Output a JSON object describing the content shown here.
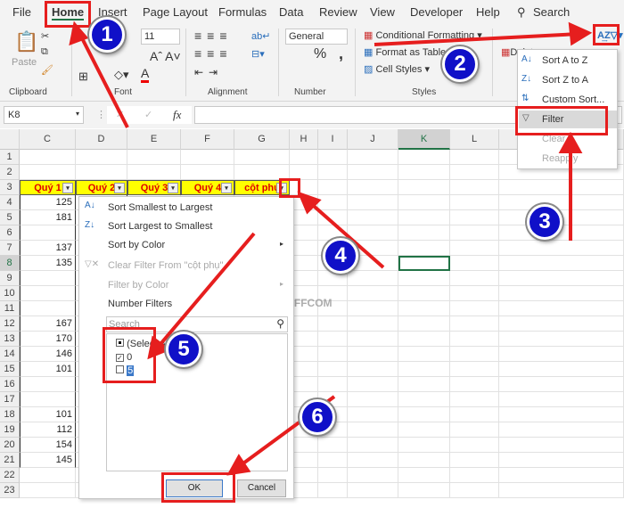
{
  "tabs": [
    "File",
    "Home",
    "Insert",
    "Page Layout",
    "Formulas",
    "Data",
    "Review",
    "View",
    "Developer",
    "Help"
  ],
  "search_label": "Search",
  "ribbon": {
    "paste": "Paste",
    "font_size": "11",
    "number_format": "General",
    "conditional_formatting": "Conditional Formatting",
    "format_as_table": "Format as Table",
    "cell_styles": "Cell Styles",
    "groups": [
      "Clipboard",
      "Font",
      "Alignment",
      "Number",
      "Styles"
    ],
    "delete": "Delete",
    "percent": "%",
    "comma": ","
  },
  "formula_bar": {
    "name_box": "K8",
    "fx": "fx",
    "value": ""
  },
  "columns": [
    "C",
    "D",
    "E",
    "F",
    "G",
    "H",
    "I",
    "J",
    "K",
    "L",
    "M"
  ],
  "header_row": [
    "Quý 1",
    "Quý 2",
    "Quý 3",
    "Quý 4",
    "cột phụ"
  ],
  "rows": [
    {
      "n": "1",
      "c": ""
    },
    {
      "n": "2",
      "c": ""
    },
    {
      "n": "3",
      "c": ""
    },
    {
      "n": "4",
      "c": "125"
    },
    {
      "n": "5",
      "c": "181"
    },
    {
      "n": "6",
      "c": ""
    },
    {
      "n": "7",
      "c": "137"
    },
    {
      "n": "8",
      "c": "135"
    },
    {
      "n": "9",
      "c": ""
    },
    {
      "n": "10",
      "c": ""
    },
    {
      "n": "11",
      "c": ""
    },
    {
      "n": "12",
      "c": "167"
    },
    {
      "n": "13",
      "c": "170"
    },
    {
      "n": "14",
      "c": "146"
    },
    {
      "n": "15",
      "c": "101"
    },
    {
      "n": "16",
      "c": ""
    },
    {
      "n": "17",
      "c": ""
    },
    {
      "n": "18",
      "c": "101"
    },
    {
      "n": "19",
      "c": "112"
    },
    {
      "n": "20",
      "c": "154"
    },
    {
      "n": "21",
      "c": "145"
    },
    {
      "n": "22",
      "c": ""
    },
    {
      "n": "23",
      "c": ""
    }
  ],
  "sort_filter_menu": {
    "items": [
      "Sort A to Z",
      "Sort Z to A",
      "Custom Sort...",
      "Filter",
      "Clear",
      "Reapply"
    ]
  },
  "filter_dropdown": {
    "sort_asc": "Sort Smallest to Largest",
    "sort_desc": "Sort Largest to Smallest",
    "sort_color": "Sort by Color",
    "clear_filter": "Clear Filter From \"cột phụ\"",
    "filter_color": "Filter by Color",
    "number_filters": "Number Filters",
    "search_placeholder": "Search",
    "values": [
      {
        "label": "(Select All)",
        "state": "partial"
      },
      {
        "label": "0",
        "state": "checked"
      },
      {
        "label": "5",
        "state": "unchecked"
      }
    ],
    "ok": "OK",
    "cancel": "Cancel"
  },
  "watermark": "BUFFCOM",
  "steps": [
    "1",
    "2",
    "3",
    "4",
    "5",
    "6"
  ],
  "colors": {
    "annotation_red": "#e61e1e",
    "step_blue": "#1010c8",
    "header_fill": "#ffff00",
    "header_text": "#e00000"
  }
}
